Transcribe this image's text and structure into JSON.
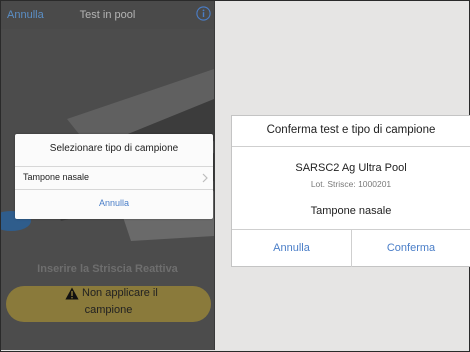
{
  "navbar": {
    "cancel_label": "Annulla",
    "title": "Test in pool",
    "info_icon": "info-icon"
  },
  "sample_dialog": {
    "title": "Selezionare tipo di campione",
    "options": [
      {
        "label": "Tampone nasale",
        "icon": "chevron-right-icon"
      }
    ],
    "cancel_label": "Annulla"
  },
  "instruction": "Inserire la Striscia Reattiva",
  "warning_button": {
    "icon": "warning-icon",
    "line1": "Non applicare il",
    "line2": "campione"
  },
  "confirm_dialog": {
    "title": "Conferma test e tipo di campione",
    "test_name": "SARSC2 Ag Ultra Pool",
    "lot": "Lot. Strisce: 1000201",
    "sample_type": "Tampone nasale",
    "cancel_label": "Annulla",
    "confirm_label": "Conferma"
  },
  "colors": {
    "accent": "#4a7ec8",
    "warning": "#8a7a3b",
    "background_dark": "#4c4c4c"
  }
}
